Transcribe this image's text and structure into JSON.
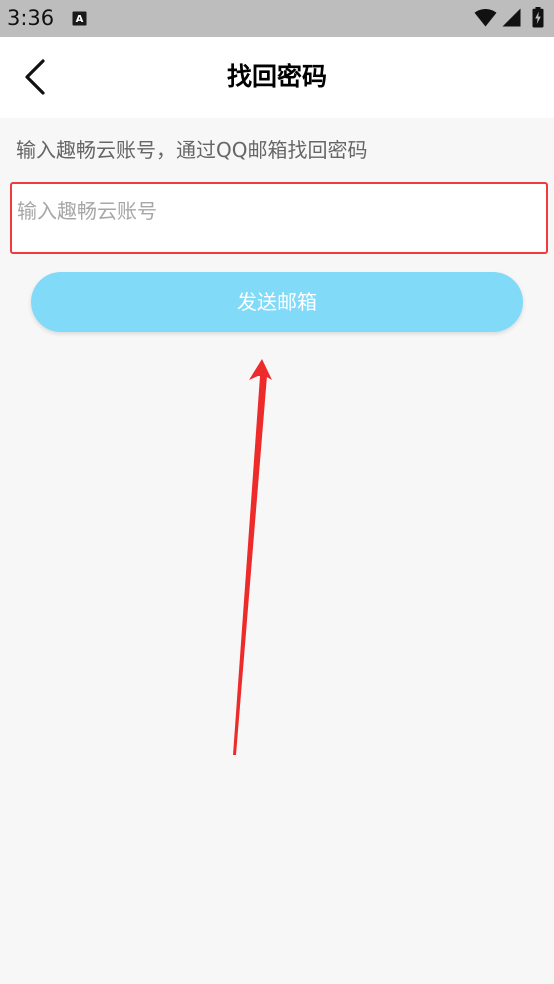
{
  "status_bar": {
    "time": "3:36",
    "app_icon": "a-letter-icon",
    "wifi_icon": "wifi-icon",
    "signal_icon": "signal-icon",
    "battery_icon": "battery-icon"
  },
  "header": {
    "title": "找回密码",
    "back_icon": "chevron-left-icon"
  },
  "instruction": "输入趣畅云账号，通过QQ邮箱找回密码",
  "account_input": {
    "placeholder": "输入趣畅云账号",
    "value": ""
  },
  "send_button": {
    "label": "发送邮箱"
  },
  "colors": {
    "status_bar": "#bdbdbd",
    "background": "#f7f7f7",
    "header": "#ffffff",
    "button": "#82daf9",
    "highlight_border": "#ef3b3b",
    "annotation_arrow": "#ee2b2b"
  }
}
